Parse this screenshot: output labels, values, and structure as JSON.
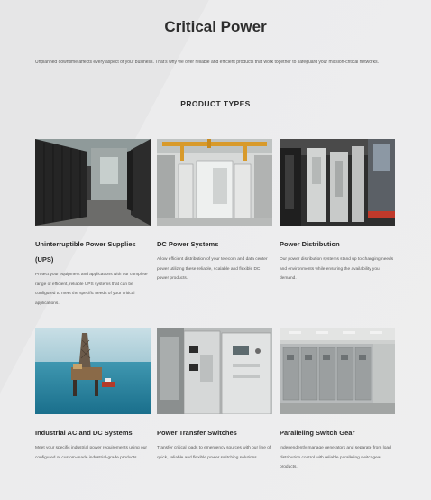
{
  "page": {
    "title": "Critical Power",
    "intro": "Unplanned downtime affects every aspect of your business. That's why we offer reliable and efficient products that work together to safeguard your mission-critical networks.",
    "section_heading": "PRODUCT TYPES"
  },
  "products": [
    {
      "title": "Uninterruptible Power Supplies (UPS)",
      "description": "Protect your equipment and applications with our complete range of efficient, reliable UPS systems that can be configured to meet the specific needs of your critical applications.",
      "image_icon": "ups-cabinets-photo"
    },
    {
      "title": "DC Power Systems",
      "description": "Allow efficient distribution of your telecom and data center power utilizing these reliable, scalable and flexible DC power products.",
      "image_icon": "dc-power-room-photo"
    },
    {
      "title": "Power Distribution",
      "description": "Our power distribution systems stand up to changing needs and environments while ensuring the availability you demand.",
      "image_icon": "power-distribution-racks-photo"
    },
    {
      "title": "Industrial AC and DC Systems",
      "description": "Meet your specific industrial power requirements using our configured or custom-made industrial-grade products.",
      "image_icon": "offshore-oil-rig-photo"
    },
    {
      "title": "Power Transfer Switches",
      "description": "Transfer critical loads to emergency sources with our line of quick, reliable and flexible power switching solutions.",
      "image_icon": "transfer-switch-panel-photo"
    },
    {
      "title": "Paralleling Switch Gear",
      "description": "Independently manage generators and separate from load distribution control with reliable paralleling switchgear products.",
      "image_icon": "switchgear-room-photo"
    }
  ],
  "colors": {
    "background": "#e9e9ea",
    "heading": "#2d2d2d",
    "body_text": "#555555"
  }
}
